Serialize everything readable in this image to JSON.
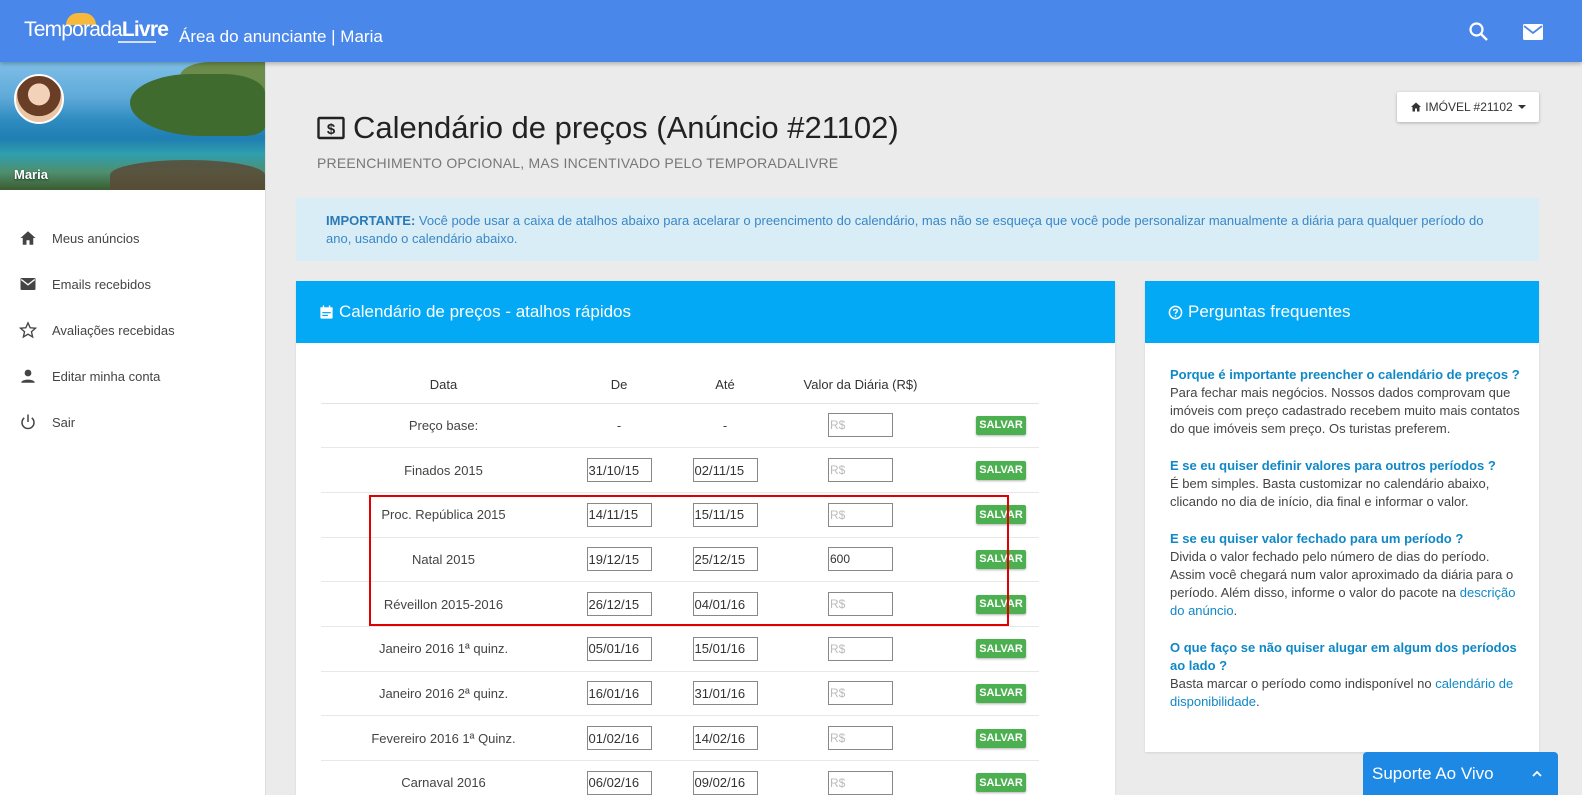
{
  "topbar": {
    "logo_part1": "Temporada",
    "logo_part2": "Livre",
    "title": "Área do anunciante | Maria"
  },
  "sidebar": {
    "profile_name": "Maria",
    "items": [
      {
        "label": "Meus anúncios",
        "icon": "home-icon"
      },
      {
        "label": "Emails recebidos",
        "icon": "mail-icon"
      },
      {
        "label": "Avaliações recebidas",
        "icon": "star-icon"
      },
      {
        "label": "Editar minha conta",
        "icon": "person-icon"
      },
      {
        "label": "Sair",
        "icon": "power-icon"
      }
    ]
  },
  "header": {
    "imovel_button": "IMÓVEL #21102",
    "title": "Calendário de preços (Anúncio #21102)",
    "subtitle": "PREENCHIMENTO OPCIONAL, MAS INCENTIVADO PELO TEMPORADALIVRE"
  },
  "alert": {
    "strong": "IMPORTANTE:",
    "text": " Você pode usar a caixa de atalhos abaixo para acelarar o preencimento do calendário, mas não se esqueça que você pode personalizar manualmente a diária para qualquer período do ano, usando o calendário abaixo."
  },
  "shortcuts": {
    "title": "Calendário de preços - atalhos rápidos",
    "columns": [
      "Data",
      "De",
      "Até",
      "Valor da Diária (R$)"
    ],
    "save_label": "SALVAR",
    "value_placeholder": "R$",
    "rows": [
      {
        "data": "Preço base:",
        "de": "-",
        "ate": "-",
        "valor": ""
      },
      {
        "data": "Finados 2015",
        "de": "31/10/15",
        "ate": "02/11/15",
        "valor": ""
      },
      {
        "data": "Proc. República 2015",
        "de": "14/11/15",
        "ate": "15/11/15",
        "valor": ""
      },
      {
        "data": "Natal 2015",
        "de": "19/12/15",
        "ate": "25/12/15",
        "valor": "600"
      },
      {
        "data": "Réveillon 2015-2016",
        "de": "26/12/15",
        "ate": "04/01/16",
        "valor": ""
      },
      {
        "data": "Janeiro 2016 1ª quinz.",
        "de": "05/01/16",
        "ate": "15/01/16",
        "valor": ""
      },
      {
        "data": "Janeiro 2016 2ª quinz.",
        "de": "16/01/16",
        "ate": "31/01/16",
        "valor": ""
      },
      {
        "data": "Fevereiro 2016 1ª Quinz.",
        "de": "01/02/16",
        "ate": "14/02/16",
        "valor": ""
      },
      {
        "data": "Carnaval 2016",
        "de": "06/02/16",
        "ate": "09/02/16",
        "valor": ""
      }
    ]
  },
  "faq": {
    "title": "Perguntas frequentes",
    "q1": "Porque é importante preencher o calendário de preços ?",
    "a1": "Para fechar mais negócios. Nossos dados comprovam que imóveis com preço cadastrado recebem muito mais contatos do que imóveis sem preço. Os turistas preferem.",
    "q2": "E se eu quiser definir valores para outros períodos ?",
    "a2": "É bem simples. Basta customizar no calendário abaixo, clicando no dia de início, dia final e informar o valor.",
    "q3": "E se eu quiser valor fechado para um período ?",
    "a3": "Divida o valor fechado pelo número de dias do período. Assim você chegará num valor aproximado da diária para o período. Além disso, informe o valor do pacote na ",
    "a3_link": "descrição do anúncio",
    "a3_end": ".",
    "q4": "O que faço se não quiser alugar em algum dos períodos ao lado ?",
    "a4": "Basta marcar o período como indisponível no ",
    "a4_link": "calendário de disponibilidade",
    "a4_end": "."
  },
  "support": {
    "label": "Suporte Ao Vivo"
  }
}
